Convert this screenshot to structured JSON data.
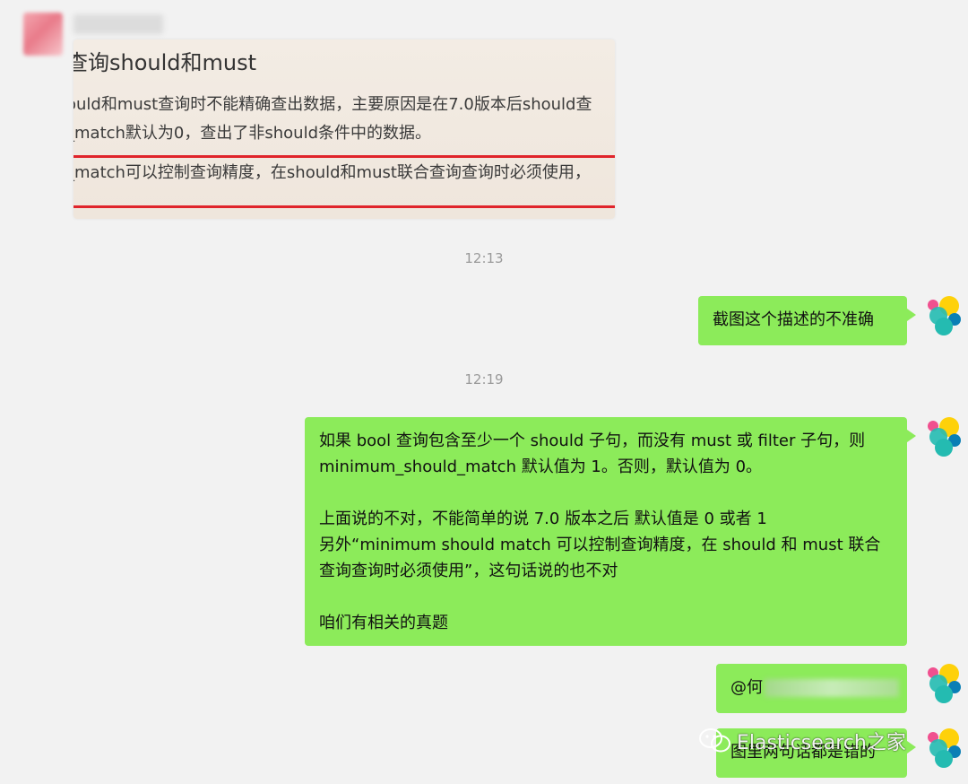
{
  "incoming": {
    "screenshot": {
      "title": "查询should和must",
      "line1": "ould和must查询时不能精确查出数据，主要原因是在7.0版本后should查",
      "line2": "_match默认为0，查出了非should条件中的数据。",
      "line3": "_match可以控制查询精度，在should和must联合查询查询时必须使用，"
    }
  },
  "timestamps": [
    "12:13",
    "12:19"
  ],
  "messages": {
    "m1": "截图这个描述的不准确",
    "m2": {
      "p1": "如果 bool 查询包含至少一个 should 子句，而没有 must 或 filter 子句，则 minimum_should_match 默认值为 1。否则，默认值为 0。",
      "p2": "上面说的不对，不能简单的说 7.0 版本之后 默认值是 0 或者 1\n另外“minimum should match 可以控制查询精度，在 should 和 must 联合查询查询时必须使用”，这句话说的也不对",
      "p3": "咱们有相关的真题"
    },
    "m3_prefix": "@何",
    "m4": "图里两句话都是错的"
  },
  "watermark": "Elasticsearch之家",
  "colors": {
    "bubble_green": "#8ceb5a",
    "background": "#f2f2f2",
    "highlight_red": "#e0242b",
    "avatar_yellow": "#fed10a",
    "avatar_pink": "#f0508f",
    "avatar_blue": "#0a7fb5",
    "avatar_teal": "#24bbb1"
  },
  "icons": {
    "sender_avatar": "blurred-avatar",
    "my_avatar": "elastic-logo-icon",
    "watermark_icon": "wechat-icon"
  }
}
